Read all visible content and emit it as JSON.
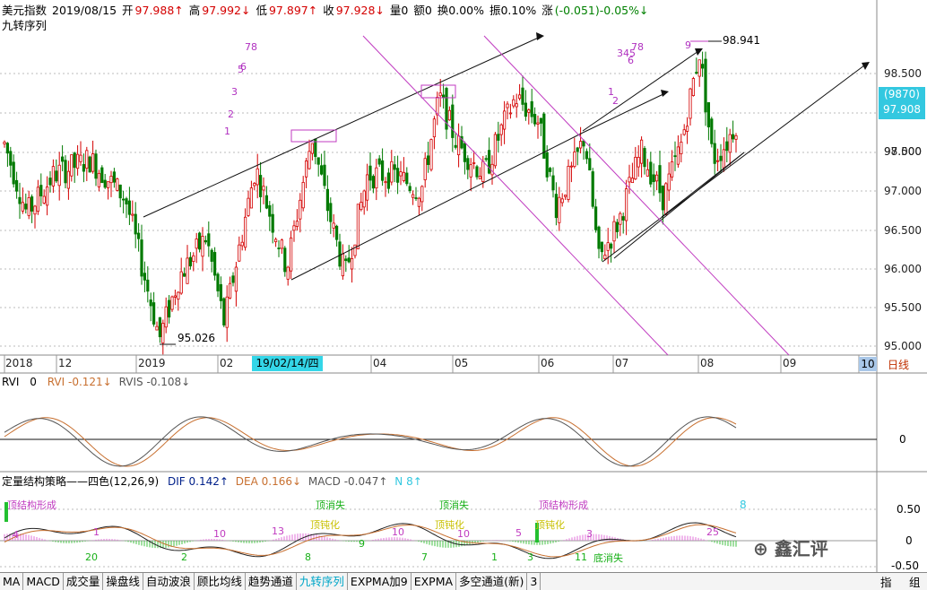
{
  "header": {
    "name": "美元指数",
    "date": "2019/08/15",
    "open_label": "开",
    "open": "97.988↑",
    "high_label": "高",
    "high": "97.992↓",
    "low_label": "低",
    "low": "97.897↑",
    "close_label": "收",
    "close": "97.928↓",
    "volume": "量0",
    "amount": "额0",
    "turnover": "换0.00%",
    "amplitude": "振0.10%",
    "change_label": "涨",
    "change": "(-0.051)-0.05%↓"
  },
  "indicator_title": "九转序列",
  "price_axis": [
    "98.500",
    "98.000",
    "97.500",
    "97.000",
    "96.500",
    "96.000",
    "95.500",
    "95.000"
  ],
  "price_marks": {
    "current_code": "(9870)",
    "current_price": "97.908",
    "high_mark": "98.941",
    "low_mark": "95.026"
  },
  "date_axis": {
    "labels": [
      "2018",
      "12",
      "2019",
      "02",
      "04",
      "05",
      "06",
      "07",
      "08",
      "09",
      "10"
    ],
    "highlight": "19/02/14/四",
    "period": "日线"
  },
  "rvi": {
    "title": "RVI",
    "param": "0",
    "rvi_label": "RVI",
    "rvi_val": "-0.121↓",
    "rvis_label": "RVIS",
    "rvis_val": "-0.108↓",
    "zero": "0"
  },
  "macd": {
    "title": "定量结构策略——四色(12,26,9)",
    "dif_label": "DIF",
    "dif": "0.142↑",
    "dea_label": "DEA",
    "dea": "0.166↓",
    "macd_label": "MACD",
    "macd": "-0.047↑",
    "n_label": "N",
    "n": "8↑",
    "axis": [
      "0.50",
      "0",
      "-0.50"
    ],
    "annotations": [
      "顶结构形成",
      "顶消失",
      "顶钝化",
      "顶消失",
      "顶钝化",
      "顶结构形成",
      "顶钝化",
      "底消失"
    ],
    "numbers": [
      "4",
      "1",
      "20",
      "2",
      "10",
      "13",
      "8",
      "9",
      "10",
      "7",
      "10",
      "5",
      "3",
      "1",
      "3",
      "11",
      "25",
      "8"
    ]
  },
  "nine_seq_marks": [
    "1",
    "2",
    "3",
    "5",
    "6",
    "78",
    "1",
    "2",
    "345",
    "6",
    "78",
    "9"
  ],
  "tabs": [
    "MA",
    "MACD",
    "成交量",
    "操盘线",
    "自动波浪",
    "顾比均线",
    "趋势通道",
    "九转序列",
    "EXPMA加9",
    "EXPMA",
    "多空通道(新)",
    "3"
  ],
  "tabs_active": "九转序列",
  "right_buttons": [
    "指",
    "组"
  ],
  "watermark": "鑫汇评",
  "colors": {
    "up": "#d40000",
    "down": "#007a00",
    "accent": "#33c8e0",
    "magenta": "#b030c0"
  }
}
